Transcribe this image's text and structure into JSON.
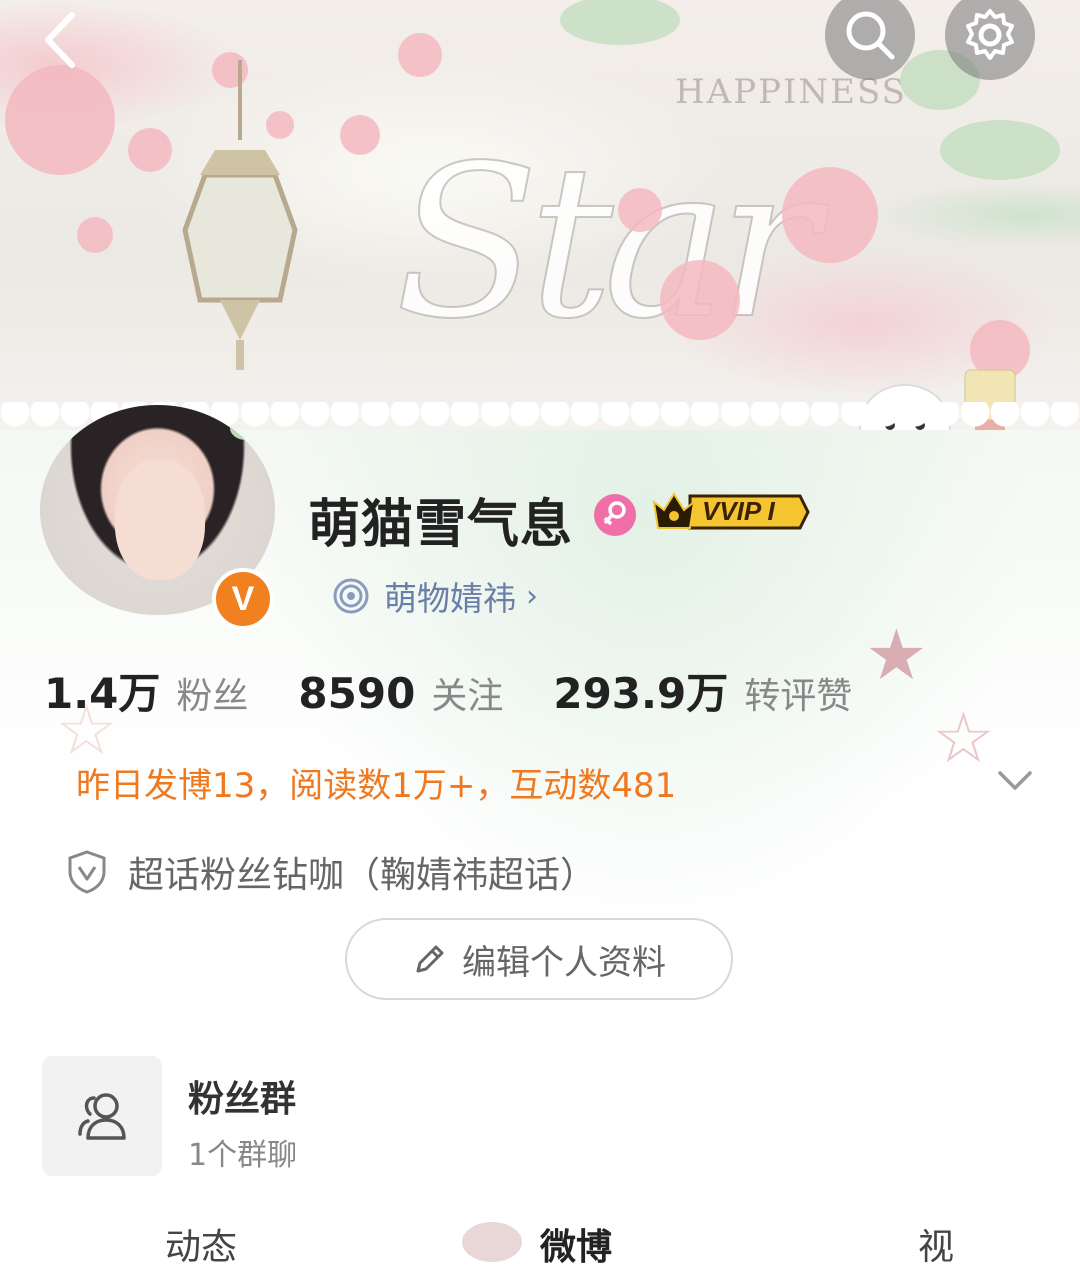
{
  "banner": {
    "script_text": "Star",
    "small_text": "HAPPINESS"
  },
  "header": {
    "back_icon": "chevron-left-icon",
    "search_icon": "search-icon",
    "settings_icon": "gear-icon"
  },
  "profile": {
    "username": "萌猫雪气息",
    "gender_icon": "female-icon",
    "vip_badge": "VVIP I",
    "verified_badge": "V",
    "supertopic_label": "萌物婧祎",
    "supertopic_chevron": "›",
    "colors": {
      "verified": "#f08020",
      "gender": "#f06fa8",
      "link": "#6a7fa8",
      "summary": "#f0781e"
    }
  },
  "stats": [
    {
      "value": "1.4万",
      "label": "粉丝"
    },
    {
      "value": "8590",
      "label": "关注"
    },
    {
      "value": "293.9万",
      "label": "转评赞"
    }
  ],
  "summary": {
    "text": "昨日发博13，阅读数1万+，互动数481",
    "expand_icon": "chevron-down-icon"
  },
  "fanclub": {
    "icon": "shield-icon",
    "text": "超话粉丝钻咖（鞠婧祎超话）"
  },
  "edit_profile": {
    "icon": "pencil-icon",
    "label": "编辑个人资料"
  },
  "fan_group": {
    "icon": "group-icon",
    "title": "粉丝群",
    "subtitle": "1个群聊"
  },
  "tabs": [
    {
      "label": "动态"
    },
    {
      "label": "微博"
    },
    {
      "label": "视"
    }
  ]
}
